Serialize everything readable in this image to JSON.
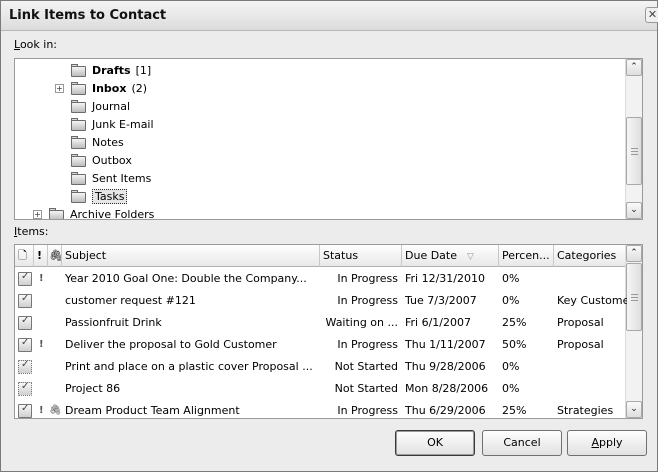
{
  "dialog": {
    "title": "Link Items to Contact",
    "close_glyph": "✕"
  },
  "look_in": {
    "label_accesskey": "L",
    "label_rest": "ook in:",
    "folders": [
      {
        "name": "Drafts",
        "count": "[1]",
        "bold": true,
        "icon": "drafts-folder-icon"
      },
      {
        "name": "Inbox",
        "count": "(2)",
        "bold": true,
        "icon": "inbox-folder-icon",
        "expander": "+"
      },
      {
        "name": "Journal",
        "count": "",
        "bold": false,
        "icon": "journal-icon"
      },
      {
        "name": "Junk E-mail",
        "count": "",
        "bold": false,
        "icon": "junk-email-folder-icon"
      },
      {
        "name": "Notes",
        "count": "",
        "bold": false,
        "icon": "notes-folder-icon"
      },
      {
        "name": "Outbox",
        "count": "",
        "bold": false,
        "icon": "outbox-folder-icon"
      },
      {
        "name": "Sent Items",
        "count": "",
        "bold": false,
        "icon": "sent-items-folder-icon"
      },
      {
        "name": "Tasks",
        "count": "",
        "bold": false,
        "icon": "tasks-folder-icon",
        "selected": true
      },
      {
        "name": "Archive Folders",
        "count": "",
        "bold": false,
        "icon": "archive-folder-icon",
        "expander": "+"
      }
    ]
  },
  "items": {
    "label_accesskey": "I",
    "label_rest": "tems:",
    "columns": {
      "icon_glyph": "🗋",
      "importance_glyph": "!",
      "attachment_glyph": "🖇",
      "subject": "Subject",
      "status": "Status",
      "due_date": "Due Date",
      "sort_glyph": "▽",
      "percent": "Percen...",
      "categories": "Categories"
    },
    "rows": [
      {
        "subject": "Year 2010 Goal One: Double the Company...",
        "status": "In Progress",
        "due": "Fri 12/31/2010",
        "percent": "0%",
        "categories": "",
        "importance": "!",
        "attachment": "",
        "icon": "task-icon"
      },
      {
        "subject": "customer request #121",
        "status": "In Progress",
        "due": "Tue 7/3/2007",
        "percent": "0%",
        "categories": "Key Customer",
        "importance": "",
        "attachment": "",
        "icon": "task-icon"
      },
      {
        "subject": "Passionfruit Drink",
        "status": "Waiting on ...",
        "due": "Fri 6/1/2007",
        "percent": "25%",
        "categories": "Proposal",
        "importance": "",
        "attachment": "",
        "icon": "task-icon"
      },
      {
        "subject": "Deliver the proposal to Gold Customer",
        "status": "In Progress",
        "due": "Thu 1/11/2007",
        "percent": "50%",
        "categories": "Proposal",
        "importance": "!",
        "attachment": "",
        "icon": "task-icon"
      },
      {
        "subject": "Print and place on a plastic cover Proposal ...",
        "status": "Not Started",
        "due": "Thu 9/28/2006",
        "percent": "0%",
        "categories": "",
        "importance": "",
        "attachment": "",
        "icon": "assigned-task-icon"
      },
      {
        "subject": "Project 86",
        "status": "Not Started",
        "due": "Mon 8/28/2006",
        "percent": "0%",
        "categories": "",
        "importance": "",
        "attachment": "",
        "icon": "assigned-task-icon"
      },
      {
        "subject": "Dream Product Team Alignment",
        "status": "In Progress",
        "due": "Thu 6/29/2006",
        "percent": "25%",
        "categories": "Strategies",
        "importance": "!",
        "attachment": "🖇",
        "icon": "task-icon"
      }
    ]
  },
  "buttons": {
    "ok": "OK",
    "cancel": "Cancel",
    "apply_accesskey": "A",
    "apply_rest": "pply"
  },
  "scroll": {
    "up_glyph": "⌃",
    "down_glyph": "⌄"
  }
}
